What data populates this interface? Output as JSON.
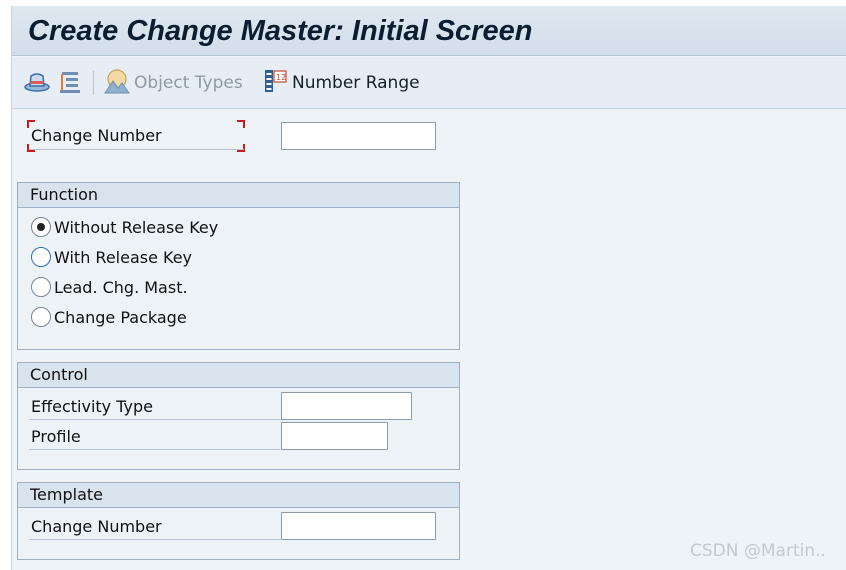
{
  "window": {
    "title": "Create Change Master: Initial Screen"
  },
  "toolbar": {
    "object_types_label": "Object Types",
    "number_range_label": "Number Range"
  },
  "header_field": {
    "label": "Change Number",
    "value": ""
  },
  "function_group": {
    "title": "Function",
    "options": [
      {
        "label": "Without Release Key",
        "selected": true
      },
      {
        "label": "With Release Key",
        "selected": false
      },
      {
        "label": "Lead. Chg. Mast.",
        "selected": false
      },
      {
        "label": "Change Package",
        "selected": false
      }
    ]
  },
  "control_group": {
    "title": "Control",
    "effectivity_type_label": "Effectivity Type",
    "effectivity_type_value": "",
    "profile_label": "Profile",
    "profile_value": ""
  },
  "template_group": {
    "title": "Template",
    "change_number_label": "Change Number",
    "change_number_value": ""
  },
  "watermark": "CSDN @Martin..",
  "colors": {
    "required_marker": "#cc1b1b",
    "title_bar": "#d2deea",
    "background": "#eef3f8"
  }
}
